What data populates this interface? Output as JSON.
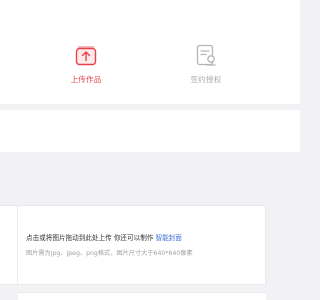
{
  "steps": [
    {
      "label": "上传作品",
      "icon": "upload-icon",
      "state": "active"
    },
    {
      "label": "签约授权",
      "icon": "sign-document-icon",
      "state": "inactive"
    }
  ],
  "upload": {
    "hint_prefix": "点击或将图片拖动到此处上传  你还可以制作",
    "hint_link": "智能封面",
    "spec": "图片需为jpg、jpeg、png格式，图片尺寸大于640*640像素"
  },
  "colors": {
    "accent": "#e8414d",
    "inactive": "#a8a8ae",
    "link": "#3b6fd6",
    "background": "#f2f2f4"
  }
}
